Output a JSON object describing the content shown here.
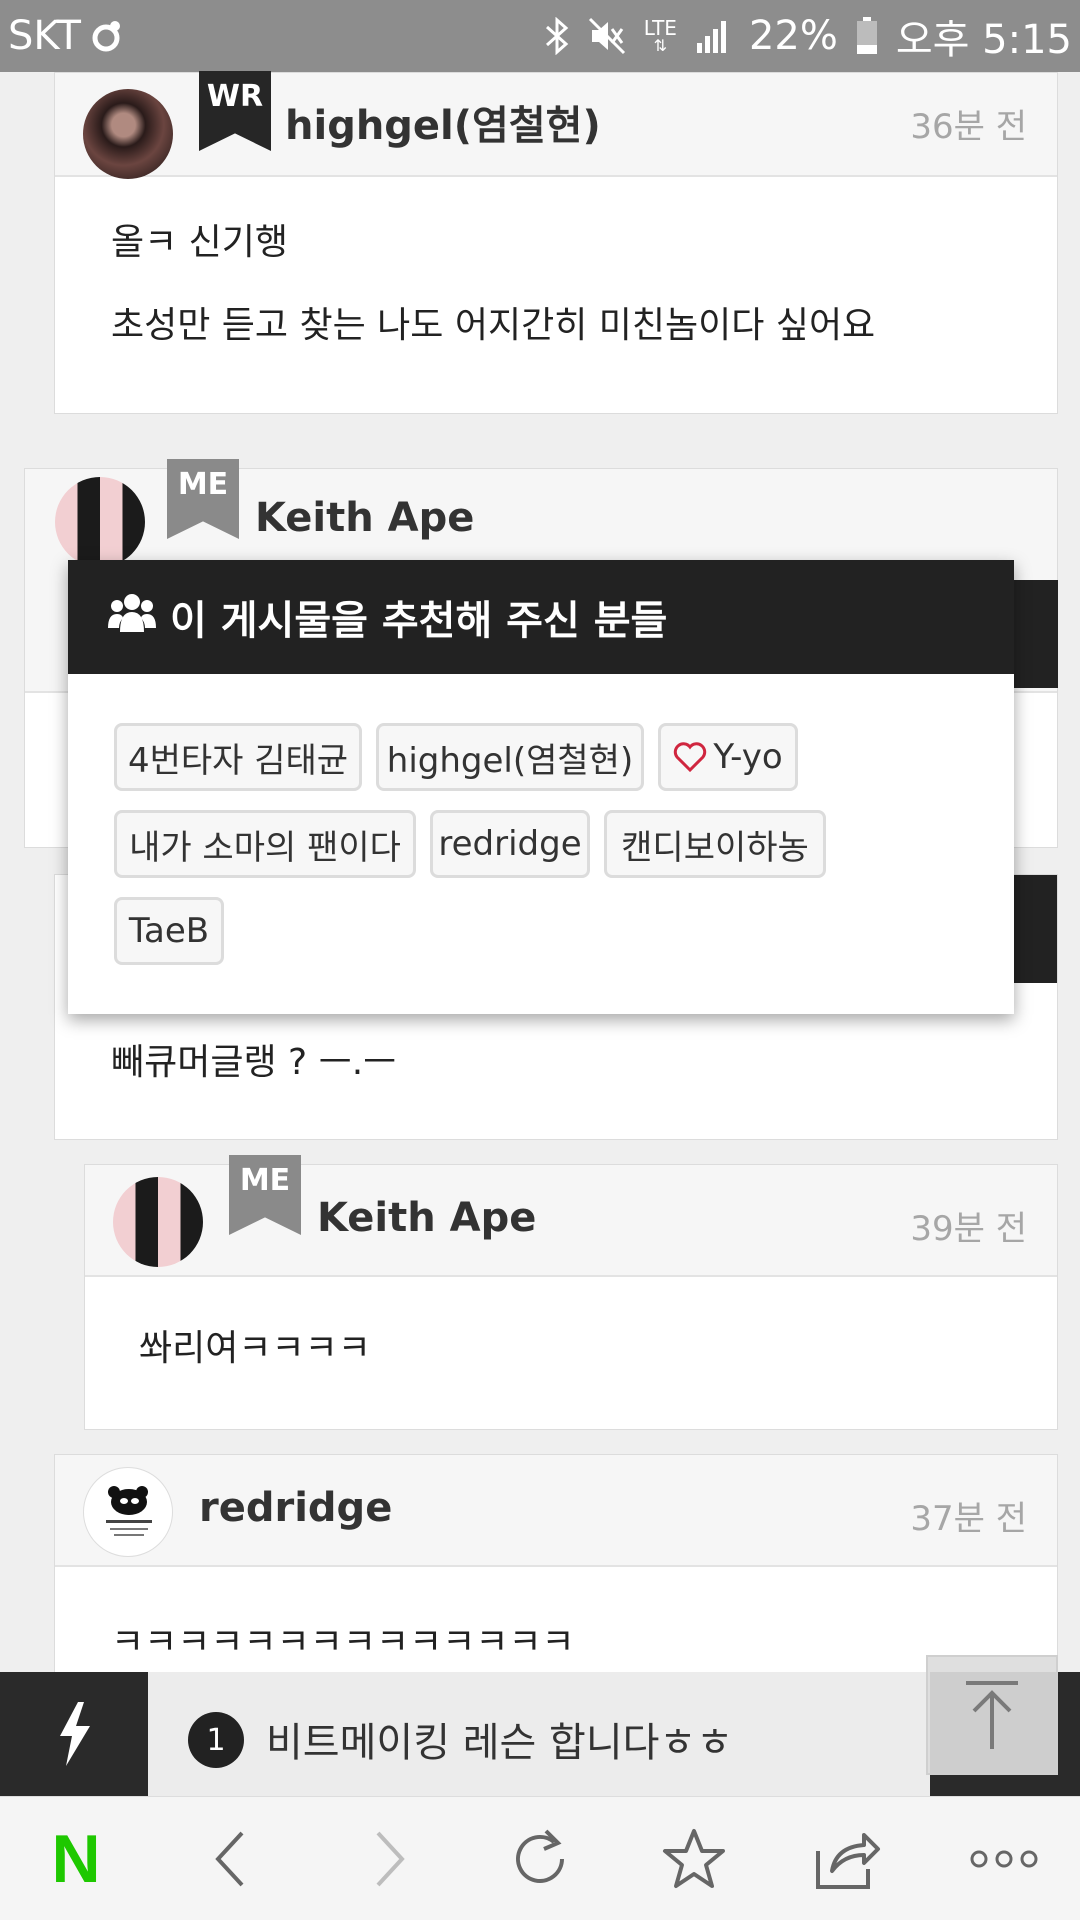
{
  "status_bar": {
    "carrier": "SKT",
    "network": "LTE",
    "battery": "22%",
    "time": "오후 5:15"
  },
  "comments": [
    {
      "badge": "WR",
      "username": "highgel(염철현)",
      "time": "36분 전",
      "lines": [
        "올ㅋ 신기행",
        "초성만 듣고 찾는 나도 어지간히 미친놈이다 싶어요"
      ]
    },
    {
      "badge": "ME",
      "username": "Keith Ape"
    },
    {
      "text": "빼큐머글랭 ? ㅡ.ㅡ"
    },
    {
      "badge": "ME",
      "username": "Keith Ape",
      "time": "39분 전",
      "lines": [
        "쏴리여ㅋㅋㅋㅋ"
      ]
    },
    {
      "username": "redridge",
      "time": "37분 전",
      "lines": [
        "ㅋㅋㅋㅋㅋㅋㅋㅋㅋㅋㅋㅋㅋㅋ"
      ]
    }
  ],
  "recommend_modal": {
    "title": "이 게시물을 추천해 주신 분들",
    "users": [
      "4번타자 김태균",
      "highgel(염철현)",
      "Y-yo",
      "내가 소마의 팬이다",
      "redridge",
      "캔디보이하농",
      "TaeB"
    ]
  },
  "notice": {
    "number": "1",
    "text": "비트메이킹 레슨 합니다ㅎㅎ"
  },
  "toolbar": {
    "home_label": "N"
  },
  "colors": {
    "dark": "#222222",
    "badge_me": "#8a8a8a",
    "naver_green": "#1ec800",
    "heart": "#d0263f"
  }
}
